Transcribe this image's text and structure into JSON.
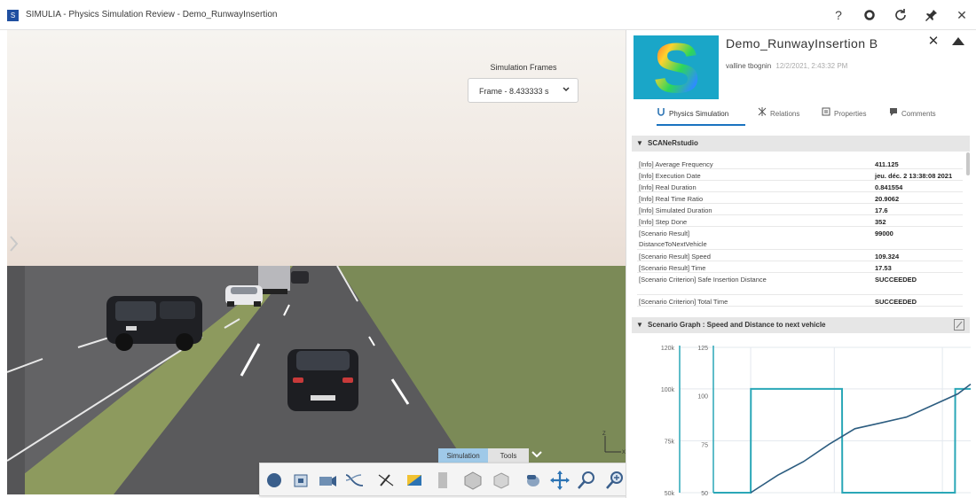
{
  "window": {
    "logo_glyph": "S",
    "title": "SIMULIA - Physics Simulation Review - Demo_RunwayInsertion",
    "icons": [
      "help-icon",
      "record-icon",
      "refresh-icon",
      "pin-icon",
      "close-icon"
    ],
    "help_glyph": "?",
    "close_glyph": "✕"
  },
  "viewport": {
    "frames_label": "Simulation Frames",
    "frame_value": "Frame - 8.433333 s",
    "scene_colors": {
      "ground_left": "#646466",
      "road": "#59595b",
      "grass_strip": "#8d9a5e",
      "grass_right": "#7b8a57"
    }
  },
  "bottom_toolbar": {
    "tabs": [
      "Simulation",
      "Tools"
    ],
    "active_tab": "Simulation",
    "tools": [
      "play-icon",
      "model-icon",
      "camera-icon",
      "curve-icon",
      "pen-off-icon",
      "color-icon",
      "section-icon",
      "assembly-icon",
      "parts-icon",
      "hand-icon",
      "move-icon",
      "zoom-area-icon",
      "zoom-icon",
      "rotate-icon",
      "cube-view-icon",
      "render-mode-icon"
    ]
  },
  "panel": {
    "title": "Demo_RunwayInsertion B",
    "owner": "valline tbognin",
    "date": "12/2/2021, 2:43:32 PM",
    "tabs": [
      {
        "label": "Physics Simulation",
        "icon": "physics-icon",
        "active": true
      },
      {
        "label": "Relations",
        "icon": "relations-icon",
        "active": false
      },
      {
        "label": "Properties",
        "icon": "properties-icon",
        "active": false
      },
      {
        "label": "Comments",
        "icon": "comments-icon",
        "active": false
      }
    ],
    "section1_title": "SCANeRstudio",
    "rows": [
      {
        "key": "[Info] Average Frequency",
        "value": "411.125"
      },
      {
        "key": "[Info] Execution Date",
        "value": "jeu. déc. 2 13:38:08 2021"
      },
      {
        "key": "[Info] Real Duration",
        "value": "0.841554"
      },
      {
        "key": "[Info] Real Time Ratio",
        "value": "20.9062"
      },
      {
        "key": "[Info] Simulated Duration",
        "value": "17.6"
      },
      {
        "key": "[Info] Step Done",
        "value": "352"
      },
      {
        "key": "[Scenario Result] DistanceToNextVehicle",
        "value": "99000"
      },
      {
        "key": "[Scenario Result] Speed",
        "value": "109.324"
      },
      {
        "key": "[Scenario Result] Time",
        "value": "17.53"
      },
      {
        "key": "[Scenario Criterion] Safe Insertion Distance",
        "value": "SUCCEEDED"
      },
      {
        "key": "[Scenario Criterion] Total Time",
        "value": "SUCCEEDED"
      }
    ],
    "section2_title": "Scenario Graph : Speed and Distance to next vehicle"
  },
  "chart_data": {
    "type": "line",
    "title": "Scenario Graph : Speed and Distance to next vehicle",
    "xlabel": "",
    "left_axis": {
      "ticks": [
        "120k",
        "100k",
        "75k",
        "50k"
      ],
      "ylim": [
        50000,
        120000
      ]
    },
    "right_axis": {
      "ticks": [
        "125",
        "100",
        "75",
        "50"
      ],
      "ylim": [
        50,
        125
      ]
    },
    "grid": true,
    "series": [
      {
        "axis": "left",
        "color": "#2aa7b7",
        "x": [
          0,
          1.45,
          1.46,
          5.0,
          5.01,
          9.39,
          9.4,
          10
        ],
        "y": [
          50000,
          50000,
          100000,
          100000,
          50000,
          50000,
          100000,
          100000
        ]
      },
      {
        "axis": "right",
        "color": "#2d5d80",
        "x": [
          1.45,
          2.5,
          3.5,
          4.5,
          5.5,
          6.5,
          7.5,
          8.5,
          9.5,
          10
        ],
        "y": [
          50,
          59,
          66,
          75,
          83,
          86,
          89,
          95,
          101,
          106
        ]
      }
    ]
  }
}
